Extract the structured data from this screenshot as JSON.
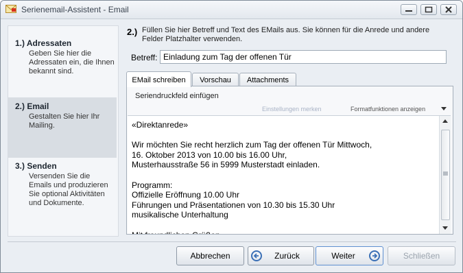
{
  "window": {
    "title": "Serienemail-Assistent - Email"
  },
  "steps": [
    {
      "title": "1.) Adressaten",
      "desc": "Geben Sie hier die Adressaten ein, die Ihnen bekannt sind."
    },
    {
      "title": "2.) Email",
      "desc": "Gestalten Sie hier Ihr Mailing."
    },
    {
      "title": "3.) Senden",
      "desc": "Versenden Sie die Emails und produzieren Sie optional Aktivitäten und Dokumente."
    }
  ],
  "hint": {
    "number": "2.)",
    "text": "Füllen Sie hier Betreff und Text des EMails aus. Sie können für die Anrede und andere Felder Platzhalter verwenden."
  },
  "betreff": {
    "label": "Betreff:",
    "value": "Einladung zum Tag der offenen Tür"
  },
  "tabs": [
    {
      "label": "EMail schreiben"
    },
    {
      "label": "Vorschau"
    },
    {
      "label": "Attachments"
    }
  ],
  "editor": {
    "insert_field": "Seriendruckfeld einfügen",
    "settings_link": "Einstellungen merken",
    "format_link": "Formatfunktionen anzeigen",
    "body": "«Direktanrede»\n\nWir möchten Sie recht herzlich zum Tag der offenen Tür Mittwoch,\n16. Oktober 2013 von 10.00 bis 16.00 Uhr,\nMusterhausstraße 56 in 5999 Musterstadt einladen.\n\nProgramm:\nOffizielle Eröffnung 10.00 Uhr\nFührungen und Präsentationen von 10.30 bis 15.30 Uhr\nmusikalische Unterhaltung\n\nMit freundlichen Grüßen"
  },
  "buttons": {
    "cancel": "Abbrechen",
    "back": "Zurück",
    "next": "Weiter",
    "close": "Schließen"
  },
  "colors": {
    "accent": "#3a6fb6",
    "active_step_bg": "#d8dde3"
  }
}
